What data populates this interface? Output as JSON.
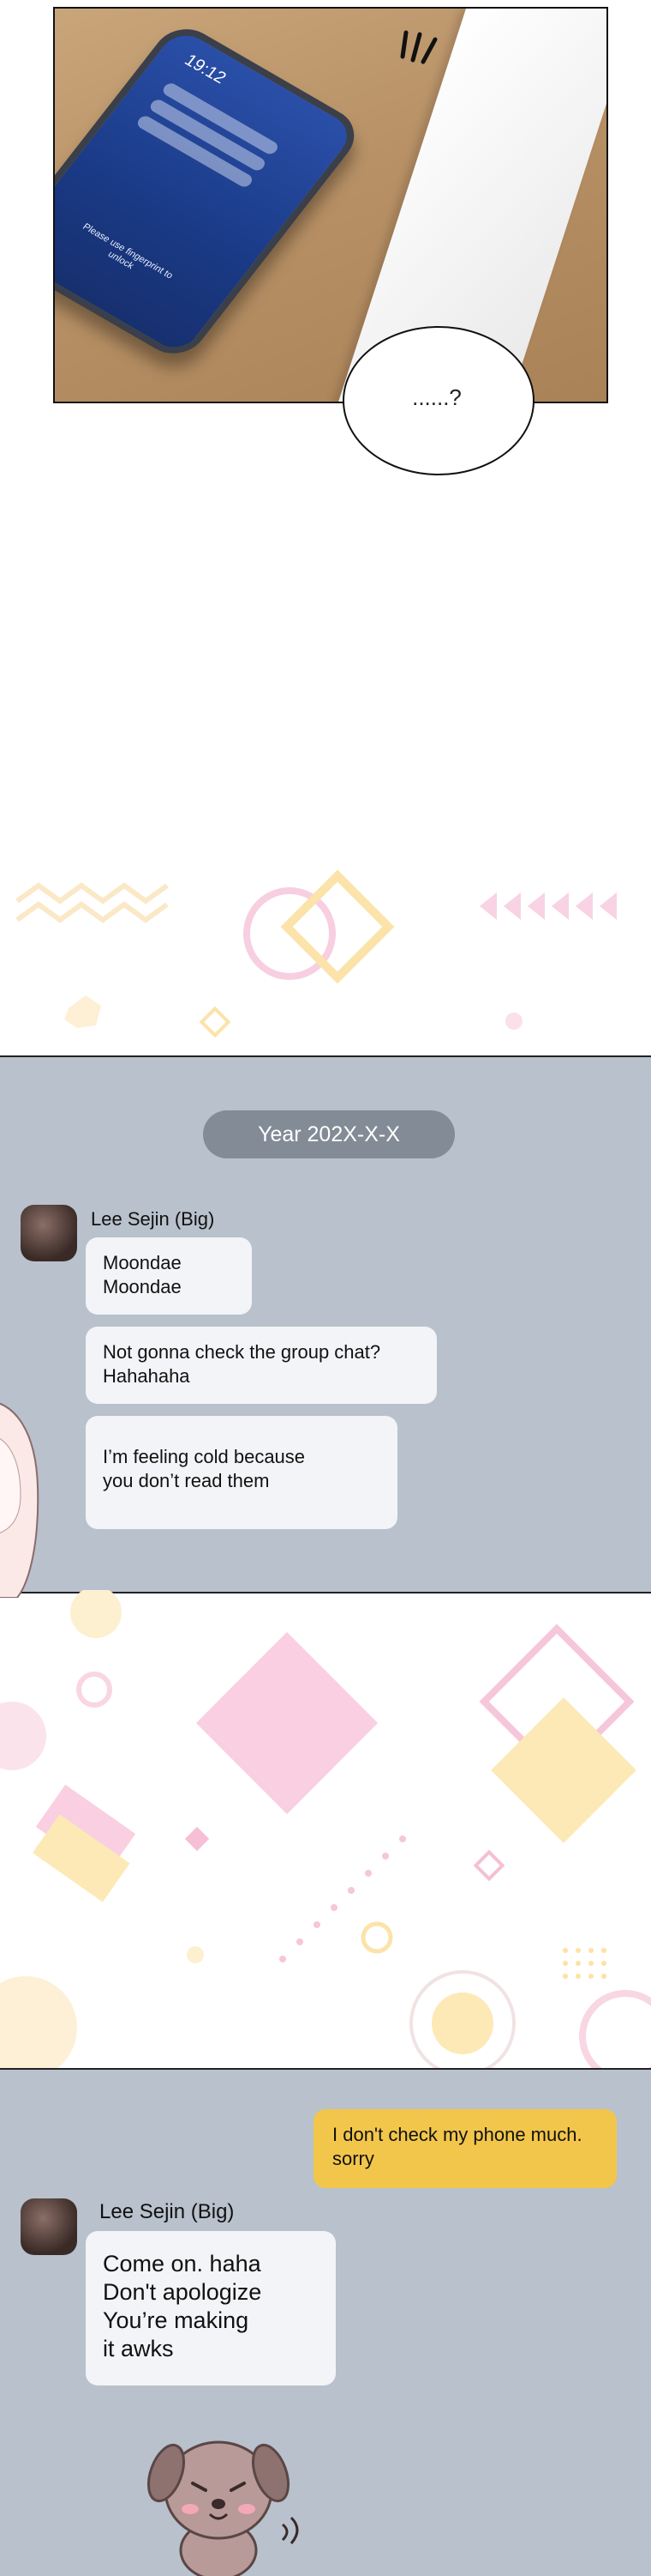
{
  "panel1": {
    "phone_time": "19:12",
    "phone_unlock_text": "Please use fingerprint to unlock",
    "bubble_text": "......?"
  },
  "chat1": {
    "date": "Year 202X-X-X",
    "sender": "Lee Sejin (Big)",
    "messages": [
      {
        "line1": "Moondae",
        "line2": "Moondae"
      },
      {
        "line1": "Not gonna check the group chat?",
        "line2": "Hahahaha"
      },
      {
        "line1": "I’m feeling cold because",
        "line2": "you don’t read them"
      }
    ]
  },
  "chat2": {
    "own_message": {
      "line1": "I don't check my phone much.",
      "line2": "sorry"
    },
    "sender": "Lee Sejin (Big)",
    "reply": {
      "line1": "Come on. haha",
      "line2": "Don't apologize",
      "line3": "You’re making",
      "line4": "it awks"
    }
  },
  "colors": {
    "chat_background": "#b8c1cc",
    "own_bubble": "#f2c64a",
    "other_bubble": "#f3f4f7",
    "date_pill": "#838b96"
  }
}
